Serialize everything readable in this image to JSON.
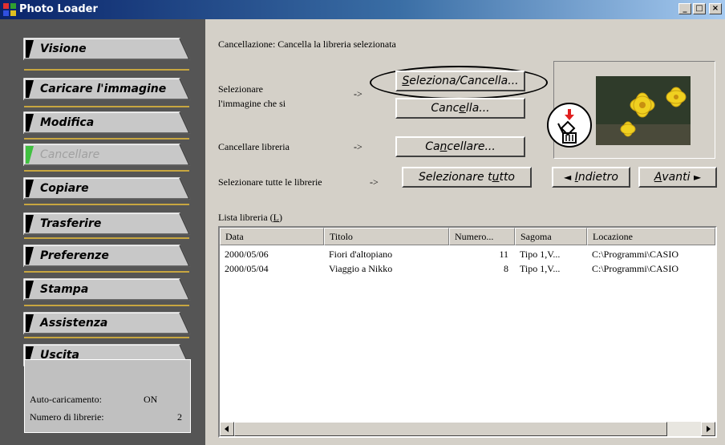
{
  "window": {
    "title": "Photo Loader",
    "min_label": "_",
    "max_label": "□",
    "close_label": "×"
  },
  "sidebar": {
    "items": [
      {
        "label": "Visione"
      },
      {
        "label": "Caricare l'immagine"
      },
      {
        "label": "Modifica"
      },
      {
        "label": "Cancellare",
        "state": "disabled"
      },
      {
        "label": "Copiare"
      },
      {
        "label": "Trasferire"
      },
      {
        "label": "Preferenze"
      },
      {
        "label": "Stampa"
      },
      {
        "label": "Assistenza"
      },
      {
        "label": "Uscita"
      }
    ],
    "status": {
      "auto_label": "Auto-caricamento:",
      "auto_value": "ON",
      "count_label": "Numero di librerie:",
      "count_value": "2"
    }
  },
  "main": {
    "header": "Cancellazione: Cancella la libreria selezionata",
    "select_image_line1": "Selezionare",
    "select_image_line2": "l'immagine che si",
    "arrow1": "->",
    "delete_library_label": "Cancellare libreria",
    "arrow2": "->",
    "select_all_label": "Selezionare tutte le librerie",
    "arrow3": "->",
    "select_delete_btn": {
      "pre": "",
      "u": "S",
      "post": "eleziona/Cancella..."
    },
    "delete_btn": {
      "pre": "Canc",
      "u": "e",
      "post": "lla..."
    },
    "cancel_library_btn": {
      "pre": "Ca",
      "u": "n",
      "post": "cellare..."
    },
    "select_all_btn": {
      "pre": "Selezionare t",
      "u": "u",
      "post": "tto"
    },
    "back_btn": {
      "arrow": "◄",
      "u": "I",
      "post": "ndietro"
    },
    "next_btn": {
      "u": "A",
      "post": "vanti",
      "arrow": "►"
    },
    "list_label_pre": "Lista libreria (",
    "list_label_u": "L",
    "list_label_post": ")",
    "columns": [
      "Data",
      "Titolo",
      "Numero...",
      "Sagoma",
      "Locazione"
    ],
    "rows": [
      [
        "2000/05/06",
        "Fiori d'altopiano",
        "11",
        "Tipo 1,V...",
        "C:\\Programmi\\CASIO"
      ],
      [
        "2000/05/04",
        "Viaggio a Nikko",
        "8",
        "Tipo 1,V...",
        "C:\\Programmi\\CASIO"
      ]
    ]
  },
  "colors": {
    "accent": "#c7a640",
    "title_start": "#0a246a",
    "sidebar_bg": "#555555"
  }
}
